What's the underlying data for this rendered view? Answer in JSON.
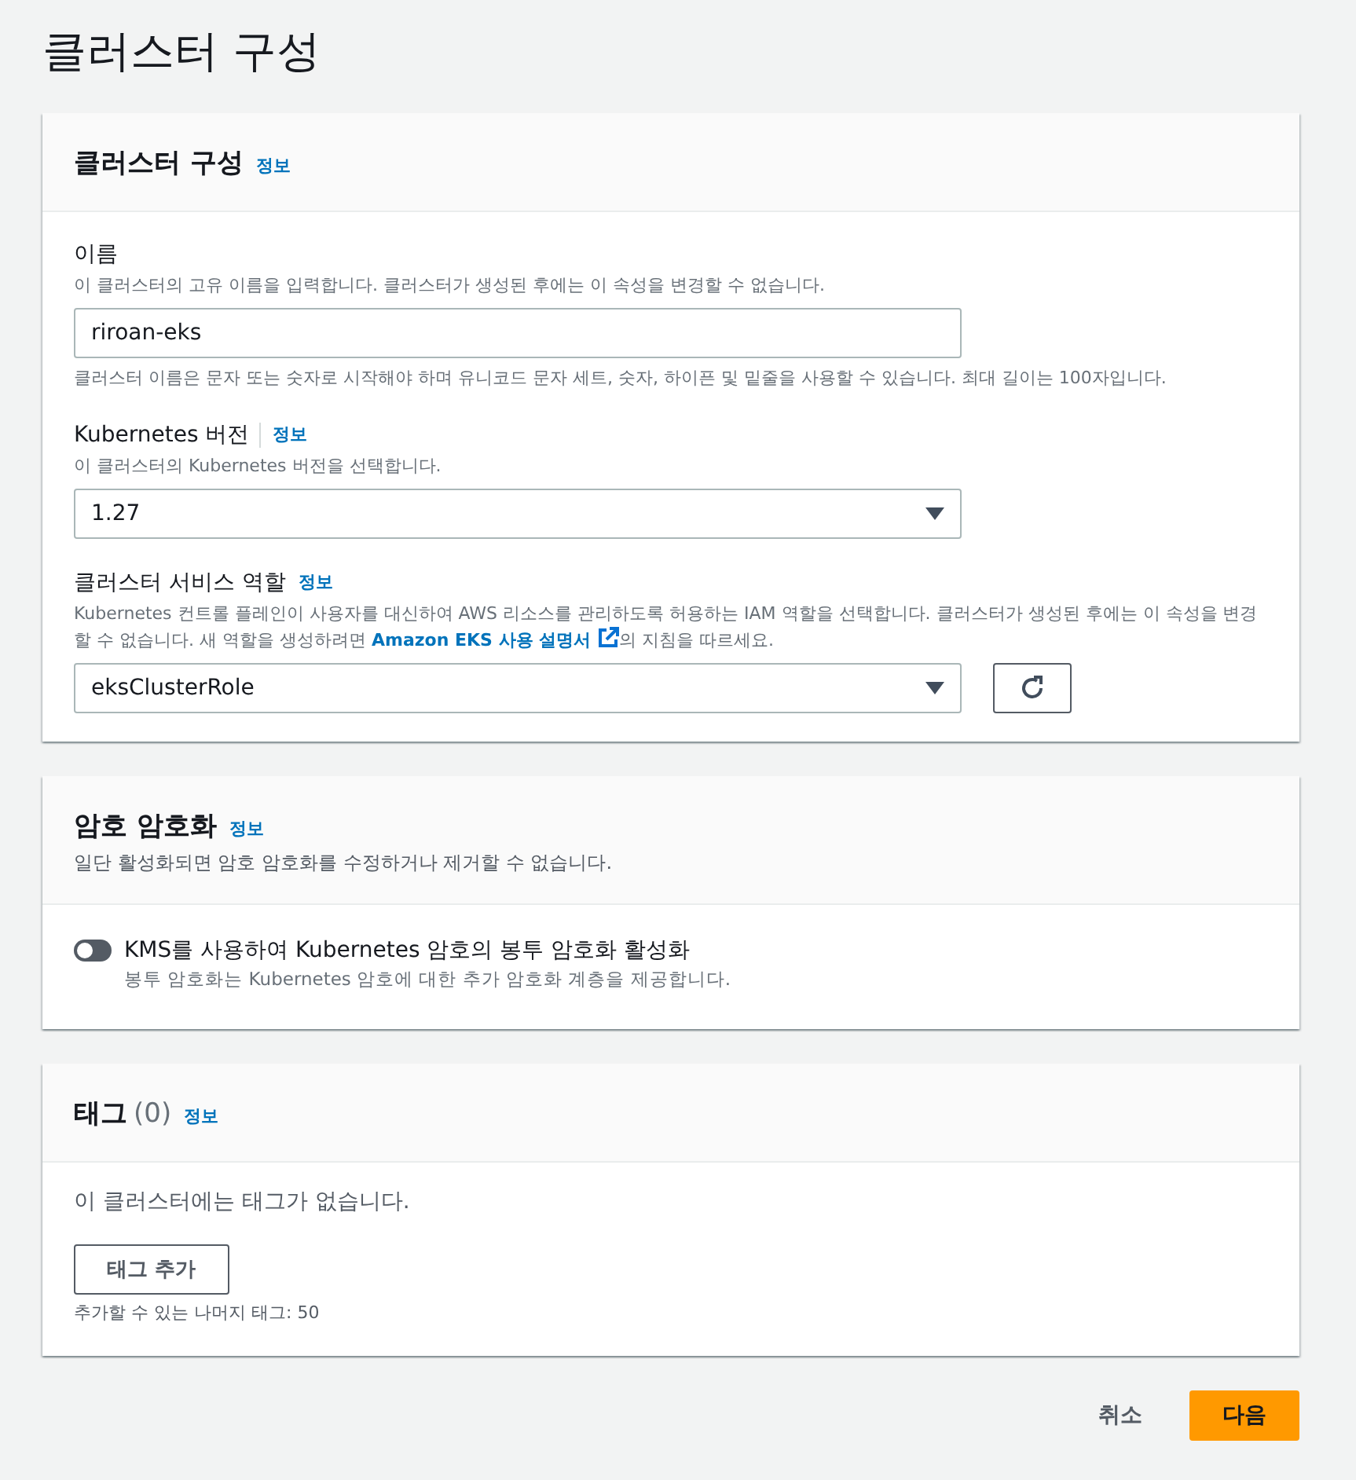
{
  "page_title": "클러스터 구성",
  "sections": [
    {
      "kind": "fields",
      "title": "클러스터 구성",
      "info": "정보",
      "fields": [
        {
          "kind": "text",
          "label": "이름",
          "description": "이 클러스터의 고유 이름을 입력합니다. 클러스터가 생성된 후에는 이 속성을 변경할 수 없습니다.",
          "value": "riroan-eks",
          "constraint": "클러스터 이름은 문자 또는 숫자로 시작해야 하며 유니코드 문자 세트, 숫자, 하이픈 및 밑줄을 사용할 수 있습니다. 최대 길이는 100자입니다."
        },
        {
          "kind": "select",
          "label": "Kubernetes 버전",
          "info": "정보",
          "divider": true,
          "description": "이 클러스터의 Kubernetes 버전을 선택합니다.",
          "value": "1.27"
        },
        {
          "kind": "select",
          "label": "클러스터 서비스 역할",
          "info": "정보",
          "divider": false,
          "description": "Kubernetes 컨트롤 플레인이 사용자를 대신하여 AWS 리소스를 관리하도록 허용하는 IAM 역할을 선택합니다. 클러스터가 생성된 후에는 이 속성을 변경할 수 없습니다. 새 역할을 생성하려면 ",
          "link": "Amazon EKS 사용 설명서",
          "description_after": "의 지침을 따르세요.",
          "value": "eksClusterRole",
          "refresh": true
        }
      ]
    },
    {
      "kind": "toggle",
      "title": "암호 암호화",
      "info": "정보",
      "subtitle": "일단 활성화되면 암호 암호화를 수정하거나 제거할 수 없습니다.",
      "toggle": {
        "label": "KMS를 사용하여 Kubernetes 암호의 봉투 암호화 활성화",
        "description": "봉투 암호화는 Kubernetes 암호에 대한 추가 암호화 계층을 제공합니다.",
        "on": false
      }
    },
    {
      "kind": "tags",
      "title": "태그",
      "count": "(0)",
      "info": "정보",
      "empty_text": "이 클러스터에는 태그가 없습니다.",
      "add_button": "태그 추가",
      "remaining": "추가할 수 있는 나머지 태그: 50"
    }
  ],
  "actions": [
    {
      "label": "취소",
      "kind": "secondary"
    },
    {
      "label": "다음",
      "kind": "primary"
    }
  ]
}
